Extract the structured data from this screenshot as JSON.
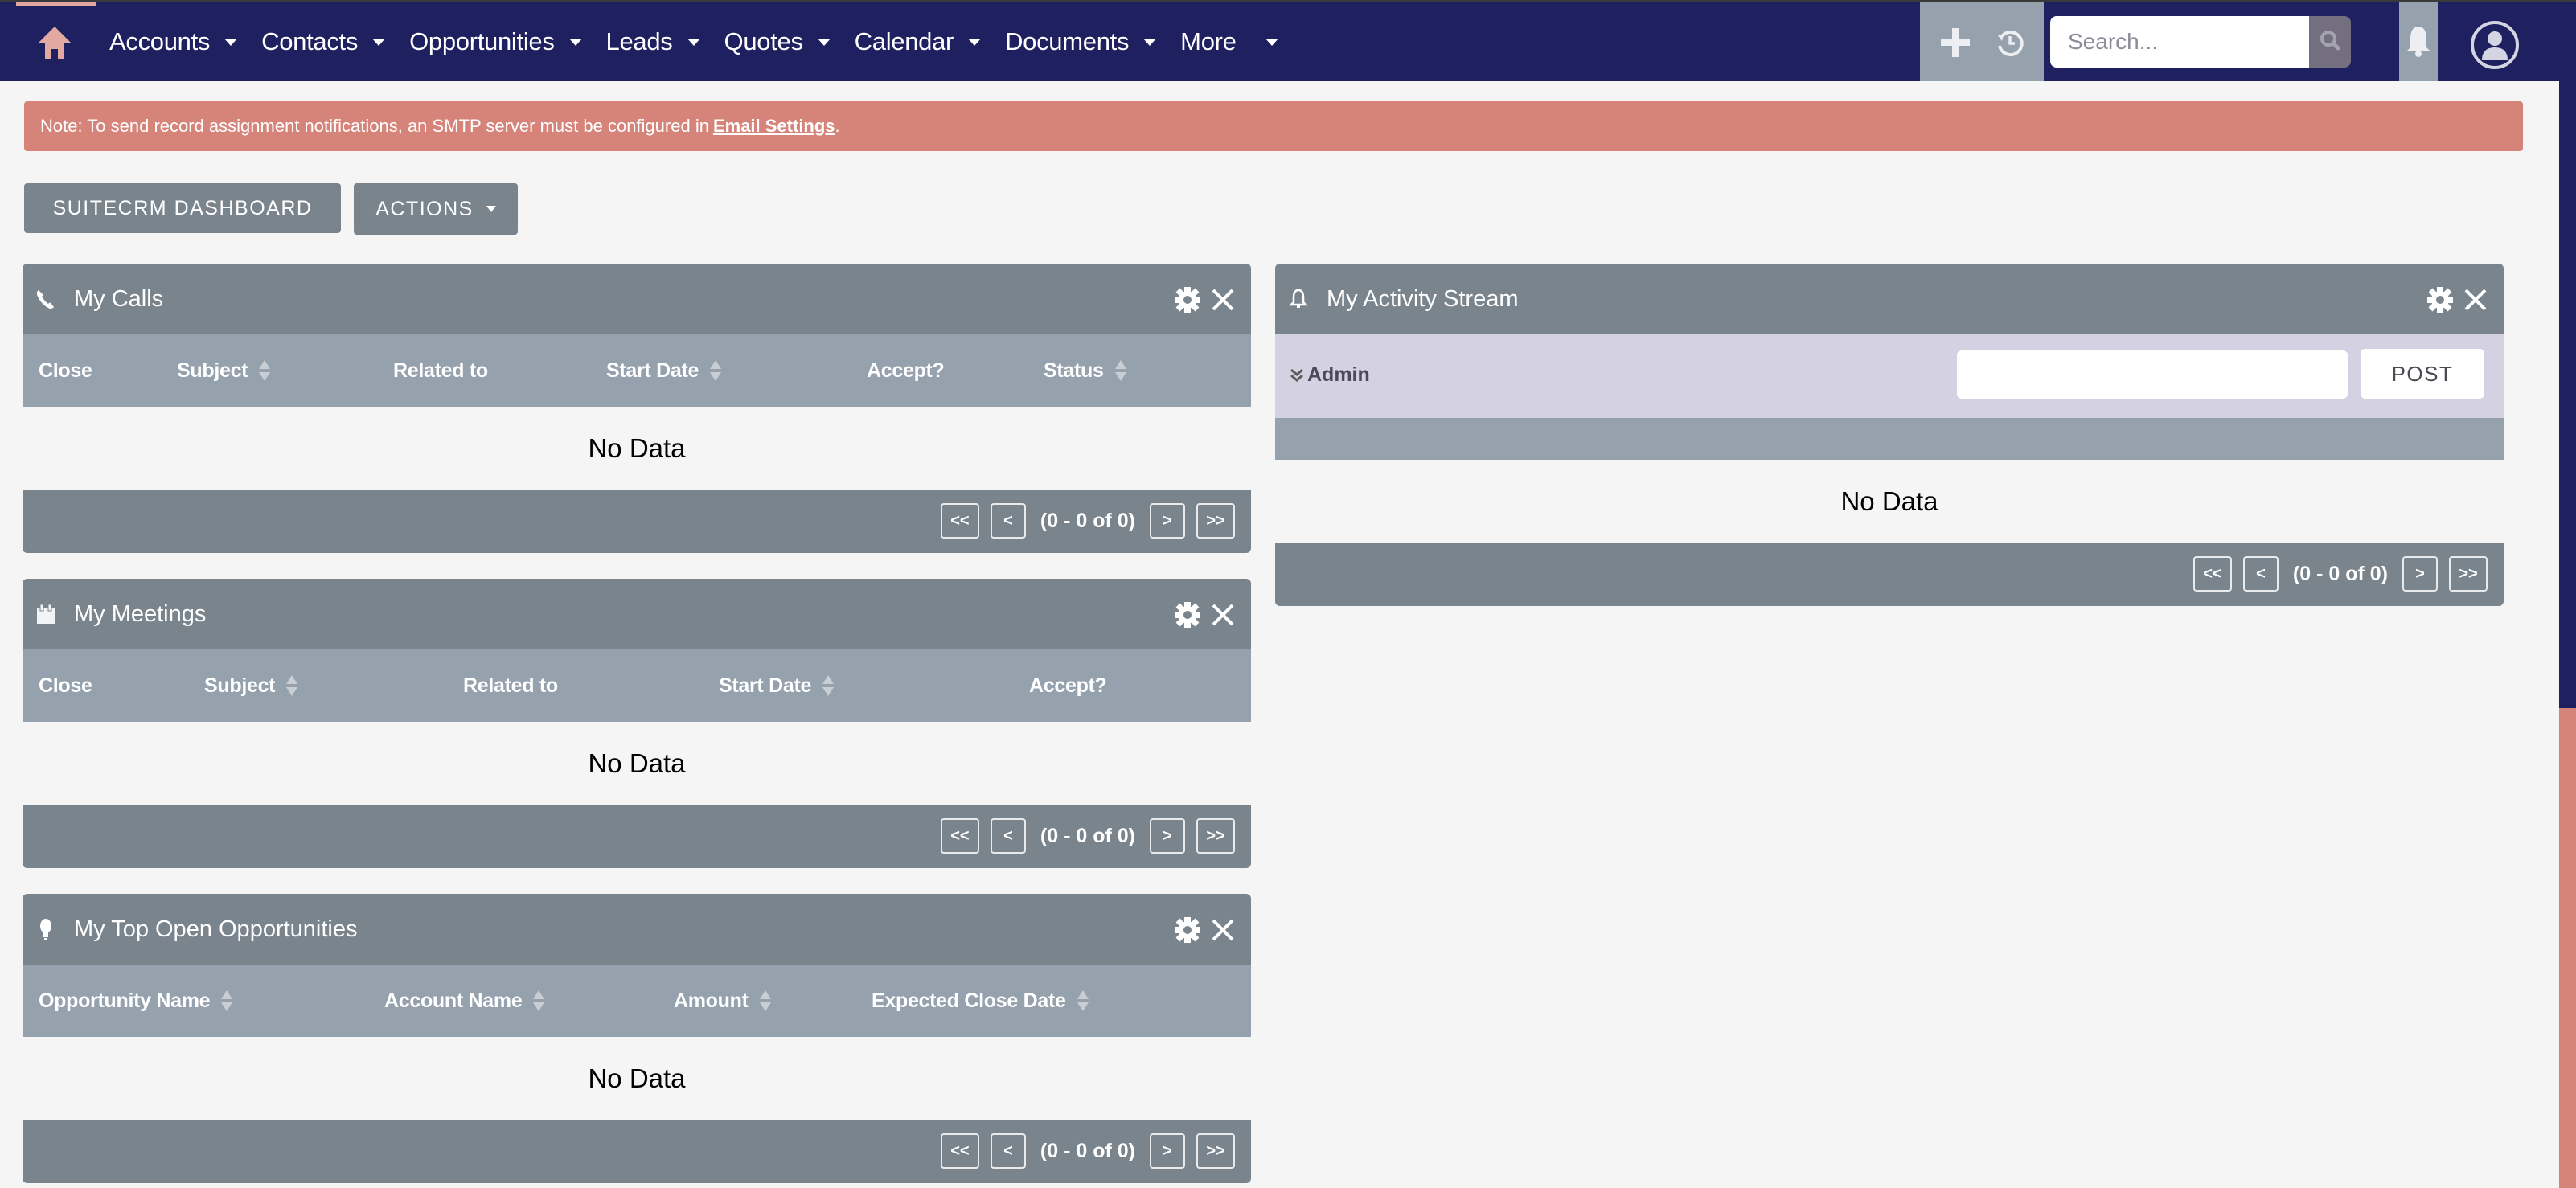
{
  "nav": {
    "home_icon": "home-icon",
    "items": [
      {
        "label": "Accounts"
      },
      {
        "label": "Contacts"
      },
      {
        "label": "Opportunities"
      },
      {
        "label": "Leads"
      },
      {
        "label": "Quotes"
      },
      {
        "label": "Calendar"
      },
      {
        "label": "Documents"
      },
      {
        "label": "More"
      }
    ],
    "search": {
      "placeholder": "Search...",
      "value": ""
    },
    "icons": [
      "plus-icon",
      "history-icon",
      "search-icon",
      "bell-icon",
      "user-icon"
    ]
  },
  "alert": {
    "text": "Note: To send record assignment notifications, an SMTP server must be configured in",
    "link": "Email Settings",
    "suffix": "."
  },
  "toolbar": {
    "dashboard_label": "SUITECRM DASHBOARD",
    "actions_label": "ACTIONS"
  },
  "dashlets": {
    "calls": {
      "title": "My Calls",
      "icon": "phone-icon",
      "columns": [
        "Close",
        "Subject",
        "Related to",
        "Start Date",
        "Accept?",
        "Status"
      ],
      "empty": "No Data",
      "pager": {
        "first": "<<",
        "prev": "<",
        "info": "(0 - 0 of 0)",
        "next": ">",
        "last": ">>"
      }
    },
    "meetings": {
      "title": "My Meetings",
      "icon": "calendar-icon",
      "columns": [
        "Close",
        "Subject",
        "Related to",
        "Start Date",
        "Accept?"
      ],
      "empty": "No Data",
      "pager": {
        "first": "<<",
        "prev": "<",
        "info": "(0 - 0 of 0)",
        "next": ">",
        "last": ">>"
      }
    },
    "opportunities": {
      "title": "My Top Open Opportunities",
      "icon": "lightbulb-icon",
      "columns": [
        "Opportunity Name",
        "Account Name",
        "Amount",
        "Expected Close Date"
      ],
      "empty": "No Data",
      "pager": {
        "first": "<<",
        "prev": "<",
        "info": "(0 - 0 of 0)",
        "next": ">",
        "last": ">>"
      }
    },
    "activity": {
      "title": "My Activity Stream",
      "icon": "bell-icon",
      "user": "Admin",
      "post_value": "",
      "post_label": "POST",
      "empty": "No Data",
      "pager": {
        "first": "<<",
        "prev": "<",
        "info": "(0 - 0 of 0)",
        "next": ">",
        "last": ">>"
      }
    }
  },
  "colors": {
    "nav_bg": "#1f205f",
    "alert_bg": "#d6847a",
    "dashlet_header": "#7a848d",
    "column_header": "#96a1ae",
    "page_bg": "#f5f5f5",
    "home_accent": "#e4a8a2"
  }
}
